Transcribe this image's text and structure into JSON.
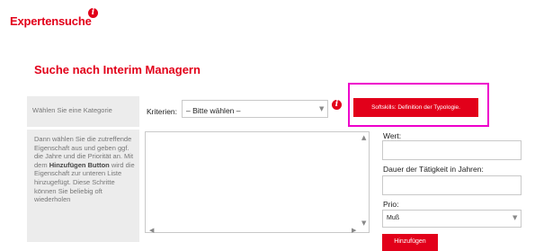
{
  "page": {
    "title": "Expertensuche",
    "info_glyph": "i"
  },
  "section": {
    "title": "Suche nach Interim Managern"
  },
  "category": {
    "label": "Wählen Sie eine Kategorie"
  },
  "criteria": {
    "label": "Kriterien:",
    "selected": "– Bitte wählen –"
  },
  "softskills_button": {
    "label": "Softskills: Definition der Typologie."
  },
  "help": {
    "line1": "Dann wählen Sie die zutreffende Eigenschaft aus und geben ggf. die Jahre und die Priorität an. Mit dem ",
    "bold": "Hinzufügen Button",
    "line2": " wird die Eigenschaft zur unteren Liste hinzugefügt. Diese Schritte können Sie beliebig oft wiederholen"
  },
  "form": {
    "wert_label": "Wert:",
    "wert_value": "",
    "dauer_label": "Dauer der Tätigkeit in Jahren:",
    "dauer_value": "",
    "prio_label": "Prio:",
    "prio_selected": "Muß",
    "add_button": "Hinzufügen"
  },
  "colors": {
    "accent": "#e2001a",
    "highlight": "#ee00cc",
    "panel": "#ececec"
  },
  "icons": {
    "info": "info-icon",
    "chevron": "chevron-down-icon",
    "scroll_up": "scroll-up-icon",
    "scroll_down": "scroll-down-icon",
    "scroll_left": "scroll-left-icon",
    "scroll_right": "scroll-right-icon"
  }
}
